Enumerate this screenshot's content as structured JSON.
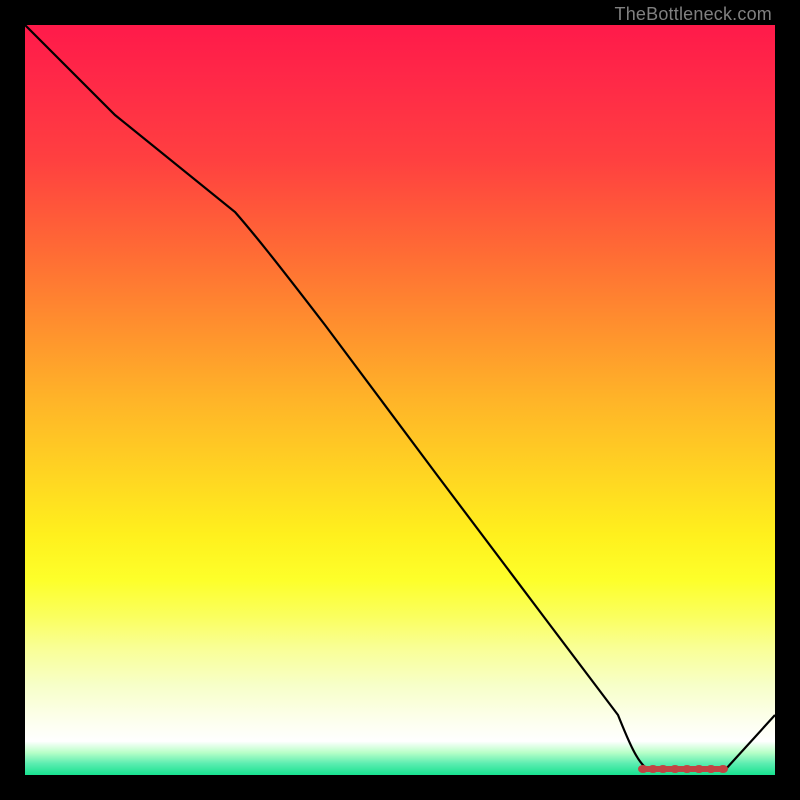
{
  "watermark": "TheBottleneck.com",
  "chart_data": {
    "type": "line",
    "x": [
      0.0,
      0.12,
      0.28,
      0.4,
      0.55,
      0.7,
      0.79,
      0.82,
      0.85,
      0.88,
      0.9,
      0.92,
      0.94,
      1.0
    ],
    "values": [
      100,
      88,
      75,
      60,
      40,
      20,
      8,
      1,
      1,
      1,
      1,
      1,
      1,
      8
    ],
    "title": "",
    "xlabel": "",
    "ylabel": "",
    "xlim": [
      0,
      1
    ],
    "ylim": [
      0,
      100
    ],
    "series": [
      {
        "name": "curve",
        "color": "#000000"
      }
    ],
    "markers": {
      "color": "#c84040",
      "points_x": [
        0.82,
        0.835,
        0.85,
        0.87,
        0.89,
        0.905,
        0.92,
        0.935
      ],
      "point_y": 1
    },
    "background_gradient": [
      "#ff1a4a",
      "#ffd522",
      "#faff60",
      "#ffffff",
      "#17e28f"
    ]
  }
}
